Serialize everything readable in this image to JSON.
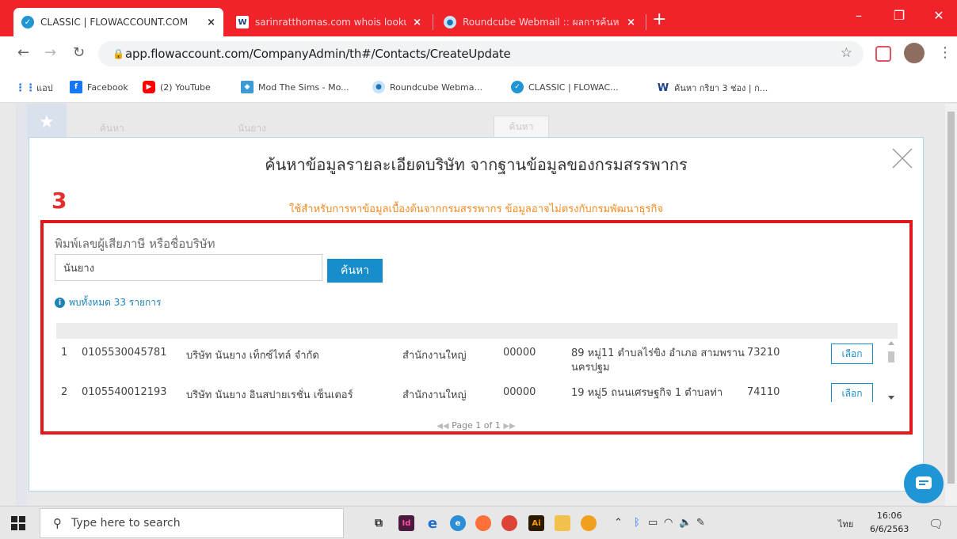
{
  "browser": {
    "tabs": [
      {
        "title": "CLASSIC | FLOWACCOUNT.COM",
        "active": true,
        "icon": "flowaccount-icon"
      },
      {
        "title": "sarinratthomas.com whois looku",
        "active": false,
        "icon": "w-icon"
      },
      {
        "title": "Roundcube Webmail :: ผลการค้นห",
        "active": false,
        "icon": "roundcube-icon"
      }
    ],
    "new_tab_symbol": "+",
    "url": "app.flowaccount.com/CompanyAdmin/th#/Contacts/CreateUpdate",
    "bookmarks": [
      {
        "label": "แอป",
        "icon": "apps-grid-icon"
      },
      {
        "label": "Facebook",
        "icon": "facebook-icon"
      },
      {
        "label": "(2) YouTube",
        "icon": "youtube-icon"
      },
      {
        "label": "Mod The Sims - Mo...",
        "icon": "modthesims-icon"
      },
      {
        "label": "Roundcube Webma...",
        "icon": "roundcube-icon"
      },
      {
        "label": "CLASSIC | FLOWAC...",
        "icon": "flowaccount-icon"
      },
      {
        "label": "ค้นหา กริยา 3 ช่อง | ก...",
        "icon": "w-icon"
      }
    ]
  },
  "background": {
    "search_placeholder": "ค้นหา",
    "search_value": "นันยาง",
    "search_button": "ค้นหา"
  },
  "modal": {
    "title": "ค้นหาข้อมูลรายละเอียดบริษัท จากฐานข้อมูลของกรมสรรพากร",
    "note": "ใช้สำหรับการหาข้อมูลเบื้องต้นจากกรมสรรพากร ข้อมูลอาจไม่ตรงกับกรมพัฒนาธุรกิจ",
    "annotation_number": "3",
    "search_label": "พิมพ์เลขผู้เสียภาษี หรือชื่อบริษัท",
    "search_value": "นันยาง",
    "search_button": "ค้นหา",
    "result_count": "พบทั้งหมด 33 รายการ",
    "rows": [
      {
        "no": "1",
        "tax_id": "0105530045781",
        "name": "บริษัท นันยาง เท็กซ์ไทล์ จำกัด",
        "branch": "สำนักงานใหญ่",
        "branch_code": "00000",
        "address": "89 หมู่11 ตำบลไร่ขิง อำเภอ สามพราน นครปฐม",
        "zip": "73210",
        "select_label": "เลือก"
      },
      {
        "no": "2",
        "tax_id": "0105540012193",
        "name": "บริษัท นันยาง อินสปายเรชั่น เซ็นเตอร์",
        "branch": "สำนักงานใหญ่",
        "branch_code": "00000",
        "address": "19 หมู่5 ถนนเศรษฐกิจ 1 ตำบลท่า",
        "zip": "74110",
        "select_label": "เลือก"
      }
    ],
    "pagination": "Page 1 of 1"
  },
  "taskbar": {
    "search_placeholder": "Type here to search",
    "language": "ไทย",
    "time": "16:06",
    "date": "6/6/2563"
  },
  "colors": {
    "tab_bar": "#f0232a",
    "primary_button": "#178ecb",
    "note_orange": "#f08a24",
    "highlight_red": "#e31919"
  }
}
